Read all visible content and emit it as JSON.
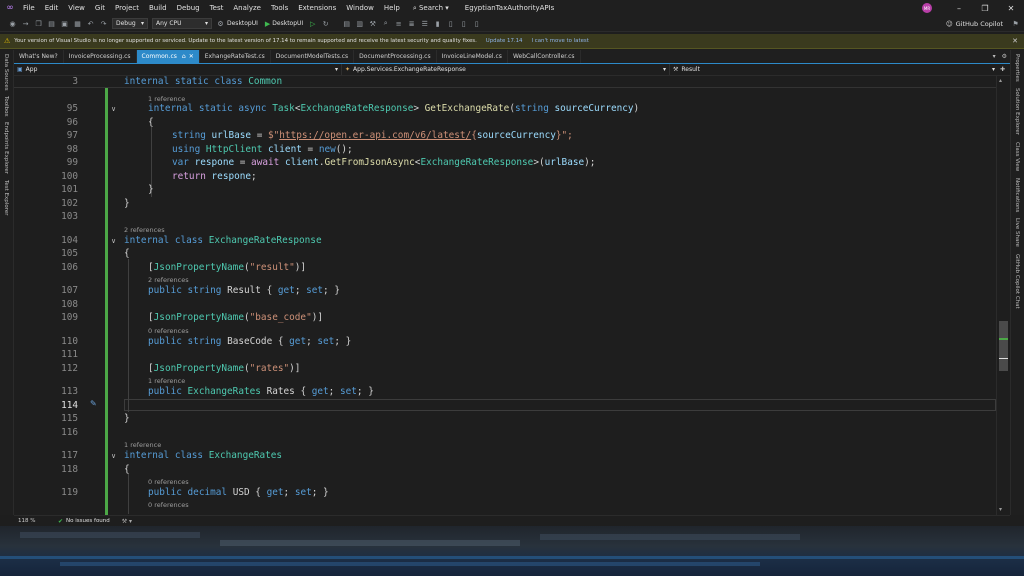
{
  "menubar": {
    "items": [
      "File",
      "Edit",
      "View",
      "Git",
      "Project",
      "Build",
      "Debug",
      "Test",
      "Analyze",
      "Tools",
      "Extensions",
      "Window",
      "Help"
    ],
    "search": "Search",
    "solution_name": "EgyptianTaxAuthorityAPIs",
    "avatar_initials": "MR"
  },
  "toolbar": {
    "config": "Debug",
    "platform": "Any CPU",
    "startup_project": "DesktopUI",
    "run_target": "DesktopUI",
    "copilot": "GitHub Copilot"
  },
  "infobar": {
    "message": "Your version of Visual Studio is no longer supported or serviced. Update to the latest version of 17.14 to remain supported and receive the latest security and quality fixes.",
    "update_link": "Update 17.14",
    "decline_link": "I can't move to latest"
  },
  "left_rail": [
    "Data Sources",
    "Toolbox",
    "Endpoints Explorer",
    "Test Explorer"
  ],
  "right_rail": [
    "Properties",
    "Solution Explorer",
    "Class View",
    "Notifications",
    "Live Share",
    "GitHub Copilot Chat"
  ],
  "tabs": [
    {
      "label": "What's New?",
      "active": false
    },
    {
      "label": "InvoiceProcessing.cs",
      "active": false
    },
    {
      "label": "Common.cs",
      "active": true
    },
    {
      "label": "ExhangeRateTest.cs",
      "active": false
    },
    {
      "label": "DocumentModelTests.cs",
      "active": false
    },
    {
      "label": "DocumentProcessing.cs",
      "active": false
    },
    {
      "label": "InvoiceLineModel.cs",
      "active": false
    },
    {
      "label": "WebCallController.cs",
      "active": false
    }
  ],
  "navbar": {
    "project": "App",
    "type": "App.Services.ExchangeRateResponse",
    "member": "Result"
  },
  "editor": {
    "lines": {
      "l3": "3",
      "l95": "95",
      "l96": "96",
      "l97": "97",
      "l98": "98",
      "l99": "99",
      "l100": "100",
      "l101": "101",
      "l102": "102",
      "l103": "103",
      "l104": "104",
      "l105": "105",
      "l106": "106",
      "l107": "107",
      "l108": "108",
      "l109": "109",
      "l110": "110",
      "l111": "111",
      "l112": "112",
      "l113": "113",
      "l114": "114",
      "l115": "115",
      "l116": "116",
      "l117": "117",
      "l118": "118",
      "l119": "119"
    },
    "lens": {
      "ref1": "1 reference",
      "ref2": "2 references",
      "ref3": "2 references",
      "ref4": "0 references",
      "ref5": "1 reference",
      "ref6": "1 reference",
      "ref7": "0 references",
      "ref8": "0 references"
    },
    "code": {
      "sticky": [
        "internal",
        " ",
        "static",
        " ",
        "class",
        " ",
        "Common"
      ],
      "c95": [
        "internal",
        " ",
        "static",
        " ",
        "async",
        " ",
        "Task",
        "<",
        "ExchangeRateResponse",
        "> ",
        "GetExchangeRate",
        "(",
        "string",
        " ",
        "sourceCurrency",
        ")"
      ],
      "c96": "{",
      "c97": [
        "string",
        " ",
        "urlBase",
        " = ",
        "$\"",
        "https://open.er-api.com/v6/latest/",
        "{",
        "sourceCurrency",
        "}",
        "\";"
      ],
      "c98": [
        "using",
        " ",
        "HttpClient",
        " ",
        "client",
        " = ",
        "new",
        "();"
      ],
      "c99": [
        "var",
        " ",
        "respone",
        " = ",
        "await",
        " ",
        "client",
        ".",
        "GetFromJsonAsync",
        "<",
        "ExchangeRateResponse",
        ">(",
        "urlBase",
        ");"
      ],
      "c100": [
        "return",
        " ",
        "respone",
        ";"
      ],
      "c101": "}",
      "c102": "}",
      "c104": [
        "internal",
        " ",
        "class",
        " ",
        "ExchangeRateResponse"
      ],
      "c105": "{",
      "c106": [
        "[",
        "JsonPropertyName",
        "(",
        "\"result\"",
        ")]"
      ],
      "c107": [
        "public",
        " ",
        "string",
        " ",
        "Result",
        " { ",
        "get",
        "; ",
        "set",
        "; }"
      ],
      "c109": [
        "[",
        "JsonPropertyName",
        "(",
        "\"base_code\"",
        ")]"
      ],
      "c110": [
        "public",
        " ",
        "string",
        " ",
        "BaseCode",
        " { ",
        "get",
        "; ",
        "set",
        "; }"
      ],
      "c112": [
        "[",
        "JsonPropertyName",
        "(",
        "\"rates\"",
        ")]"
      ],
      "c113": [
        "public",
        " ",
        "ExchangeRates",
        " ",
        "Rates",
        " { ",
        "get",
        "; ",
        "set",
        "; }"
      ],
      "c115": "}",
      "c117": [
        "internal",
        " ",
        "class",
        " ",
        "ExchangeRates"
      ],
      "c118": "{",
      "c119": [
        "public",
        " ",
        "decimal",
        " ",
        "USD",
        " { ",
        "get",
        "; ",
        "set",
        "; }"
      ]
    }
  },
  "status": {
    "zoom": "118 %",
    "issues": "No issues found"
  },
  "colors": {
    "accent": "#2d8ac9",
    "keyword": "#569cd6",
    "type": "#4ec9b0",
    "method": "#dcdcaa",
    "string": "#ce9178",
    "param": "#9cdcfe",
    "control": "#d8a0df",
    "modified": "#4ca847"
  }
}
